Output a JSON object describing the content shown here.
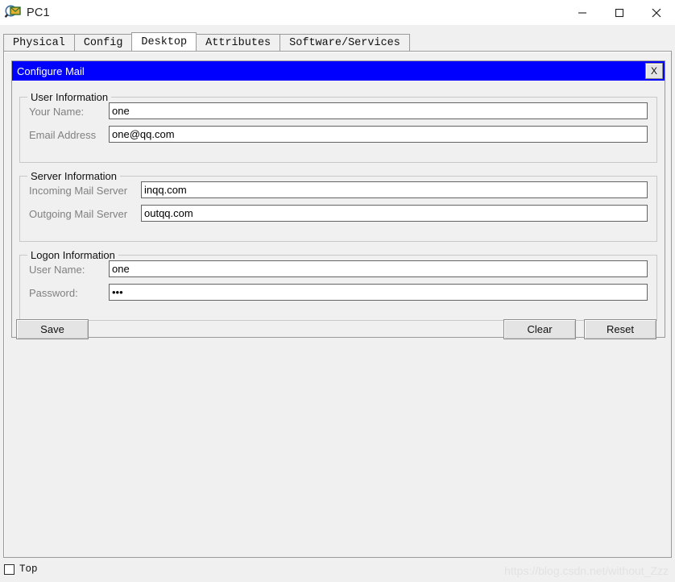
{
  "window": {
    "title": "PC1",
    "icon": "pc-magnifier-icon",
    "controls": {
      "minimize": "minimize-icon",
      "maximize": "maximize-icon",
      "close": "close-icon"
    }
  },
  "tabs": [
    {
      "label": "Physical",
      "selected": false
    },
    {
      "label": "Config",
      "selected": false
    },
    {
      "label": "Desktop",
      "selected": true
    },
    {
      "label": "Attributes",
      "selected": false
    },
    {
      "label": "Software/Services",
      "selected": false
    }
  ],
  "dialog": {
    "title": "Configure Mail",
    "close_label": "X",
    "title_bg": "#0000ff",
    "groups": [
      {
        "legend": "User Information",
        "fields": [
          {
            "label": "Your Name:",
            "value": "one",
            "placeholder": "",
            "type": "text"
          },
          {
            "label": "Email Address",
            "value": "one@qq.com",
            "placeholder": "",
            "type": "text"
          }
        ]
      },
      {
        "legend": "Server Information",
        "fields": [
          {
            "label": "Incoming Mail Server",
            "value": "inqq.com",
            "placeholder": "",
            "type": "text"
          },
          {
            "label": "Outgoing Mail Server",
            "value": "outqq.com",
            "placeholder": "",
            "type": "text"
          }
        ]
      },
      {
        "legend": "Logon Information",
        "fields": [
          {
            "label": "User Name:",
            "value": "one",
            "placeholder": "",
            "type": "text"
          },
          {
            "label": "Password:",
            "value": "•••",
            "placeholder": "",
            "type": "password"
          }
        ]
      }
    ],
    "buttons": {
      "save": "Save",
      "clear": "Clear",
      "reset": "Reset"
    }
  },
  "bottom": {
    "top_checkbox_label": "Top",
    "top_checked": false,
    "watermark": "https://blog.csdn.net/without_Zzz"
  }
}
